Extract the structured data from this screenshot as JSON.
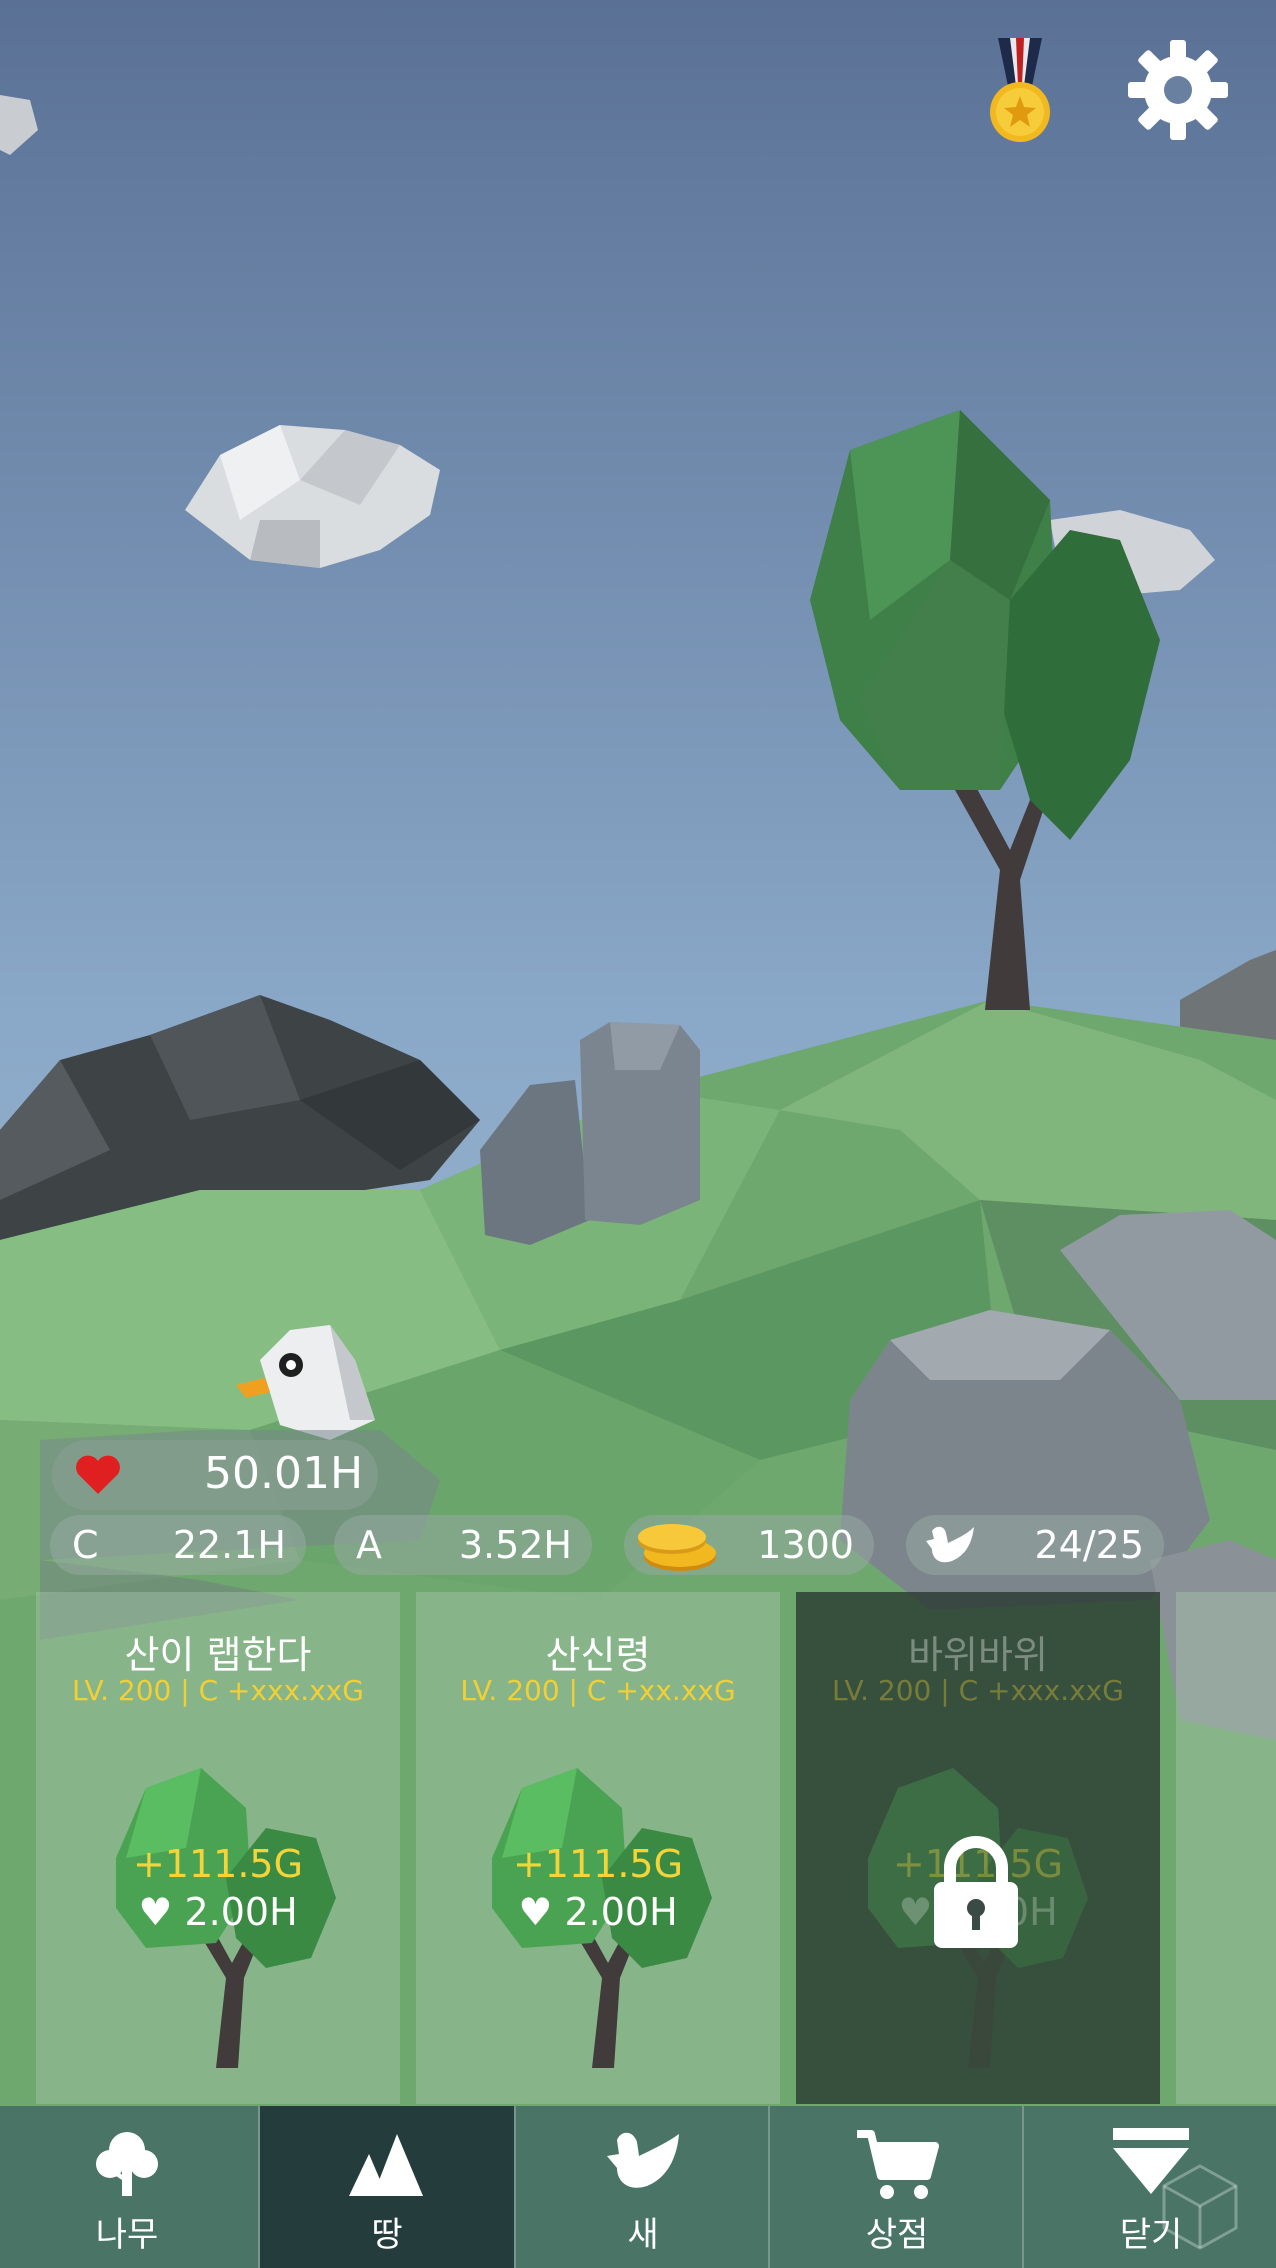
{
  "stats": {
    "hearts": "50.01H",
    "c_label": "C",
    "c_value": "22.1H",
    "a_label": "A",
    "a_value": "3.52H",
    "coins": "1300",
    "birds": "24/25"
  },
  "cards": [
    {
      "title": "산이 랩한다",
      "sub": "LV. 200 | C +xxx.xxG",
      "gold": "+111.5G",
      "hp": "2.00H",
      "locked": false
    },
    {
      "title": "산신령",
      "sub": "LV. 200 | C +xx.xxG",
      "gold": "+111.5G",
      "hp": "2.00H",
      "locked": false
    },
    {
      "title": "바위바위",
      "sub": "LV. 200 | C +xxx.xxG",
      "gold": "+111.5G",
      "hp": "2.00H",
      "locked": true
    }
  ],
  "nav": [
    {
      "label": "나무",
      "icon": "tree-icon"
    },
    {
      "label": "땅",
      "icon": "mountain-icon"
    },
    {
      "label": "새",
      "icon": "bird-icon"
    },
    {
      "label": "상점",
      "icon": "cart-icon"
    },
    {
      "label": "닫기",
      "icon": "close-arrow-icon"
    }
  ],
  "colors": {
    "nav_bg": "#4a7566",
    "nav_active": "#243d3c",
    "gold_text": "#f2cf35",
    "heart": "#e02020"
  }
}
